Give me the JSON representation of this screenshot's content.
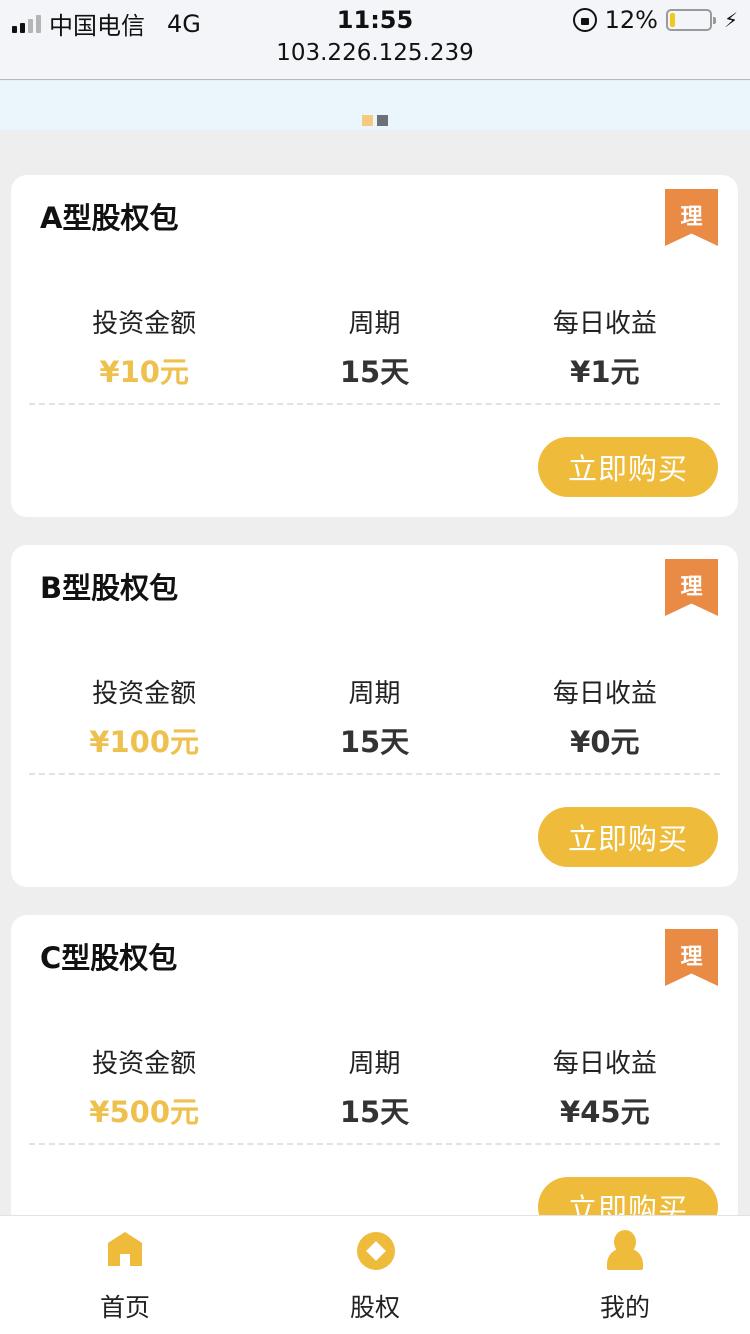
{
  "status_bar": {
    "carrier": "中国电信",
    "network": "4G",
    "time": "11:55",
    "url": "103.226.125.239",
    "battery_percent_text": "12%",
    "battery_level": 0.12,
    "charging_icon": "⚡"
  },
  "banner": {
    "dots": [
      {
        "color": "#f5c97f",
        "active": true
      },
      {
        "color": "#6d7177",
        "active": false
      }
    ]
  },
  "colors": {
    "accent": "#eebb3b",
    "amount_gold": "#eec04d",
    "ribbon": "#e98a45"
  },
  "products": [
    {
      "title": "A型股权包",
      "badge": "理",
      "stats": [
        {
          "label": "投资金额",
          "value": "¥10元"
        },
        {
          "label": "周期",
          "value": "15天"
        },
        {
          "label": "每日收益",
          "value": "¥1元"
        }
      ],
      "button": "立即购买"
    },
    {
      "title": "B型股权包",
      "badge": "理",
      "stats": [
        {
          "label": "投资金额",
          "value": "¥100元"
        },
        {
          "label": "周期",
          "value": "15天"
        },
        {
          "label": "每日收益",
          "value": "¥0元"
        }
      ],
      "button": "立即购买"
    },
    {
      "title": "C型股权包",
      "badge": "理",
      "stats": [
        {
          "label": "投资金额",
          "value": "¥500元"
        },
        {
          "label": "周期",
          "value": "15天"
        },
        {
          "label": "每日收益",
          "value": "¥45元"
        }
      ],
      "button": "立即购买"
    }
  ],
  "tabbar": {
    "items": [
      {
        "label": "首页",
        "icon": "home-icon"
      },
      {
        "label": "股权",
        "icon": "coin-icon"
      },
      {
        "label": "我的",
        "icon": "user-icon"
      }
    ]
  }
}
